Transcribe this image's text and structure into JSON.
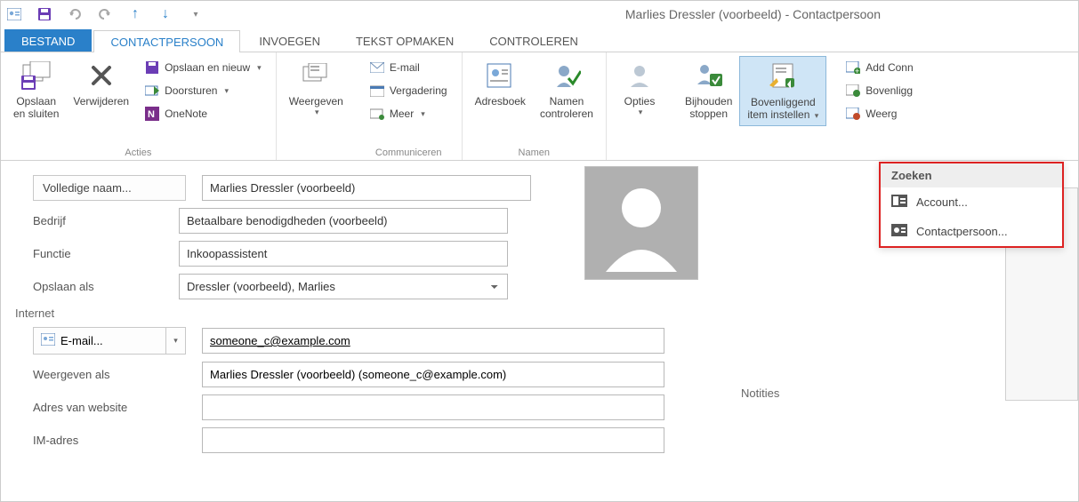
{
  "window": {
    "title": "Marlies Dressler (voorbeeld) - Contactpersoon"
  },
  "tabs": {
    "file": "BESTAND",
    "contact": "CONTACTPERSOON",
    "insert": "INVOEGEN",
    "format": "TEKST OPMAKEN",
    "review": "CONTROLEREN"
  },
  "ribbon": {
    "actions": {
      "label": "Acties",
      "save_close_line1": "Opslaan",
      "save_close_line2": "en sluiten",
      "delete": "Verwijderen",
      "save_new": "Opslaan en nieuw",
      "forward": "Doorsturen",
      "onenote": "OneNote"
    },
    "show": {
      "label": "Weergeven"
    },
    "communicate": {
      "label": "Communiceren",
      "email": "E-mail",
      "meeting": "Vergadering",
      "more": "Meer"
    },
    "names": {
      "label": "Namen",
      "addressbook": "Adresboek",
      "check_line1": "Namen",
      "check_line2": "controleren"
    },
    "options": {
      "label": "Opties"
    },
    "track": {
      "line1": "Bijhouden",
      "line2": "stoppen"
    },
    "parent": {
      "line1": "Bovenliggend",
      "line2": "item instellen"
    },
    "crm": {
      "addconn": "Add Conn",
      "parent2": "Bovenligg",
      "show2": "Weerg"
    }
  },
  "form": {
    "fullname_btn": "Volledige naam...",
    "fullname_val": "Marlies Dressler (voorbeeld)",
    "company_lbl": "Bedrijf",
    "company_val": "Betaalbare benodigdheden (voorbeeld)",
    "jobtitle_lbl": "Functie",
    "jobtitle_val": "Inkoopassistent",
    "fileas_lbl": "Opslaan als",
    "fileas_val": "Dressler (voorbeeld), Marlies",
    "internet_hdr": "Internet",
    "email_btn": "E-mail...",
    "email_val": "someone_c@example.com",
    "displayas_lbl": "Weergeven als",
    "displayas_val": "Marlies Dressler (voorbeeld) (someone_c@example.com)",
    "website_lbl": "Adres van website",
    "im_lbl": "IM-adres",
    "notes_lbl": "Notities"
  },
  "popup": {
    "header": "Zoeken",
    "account": "Account...",
    "contact": "Contactpersoon..."
  }
}
